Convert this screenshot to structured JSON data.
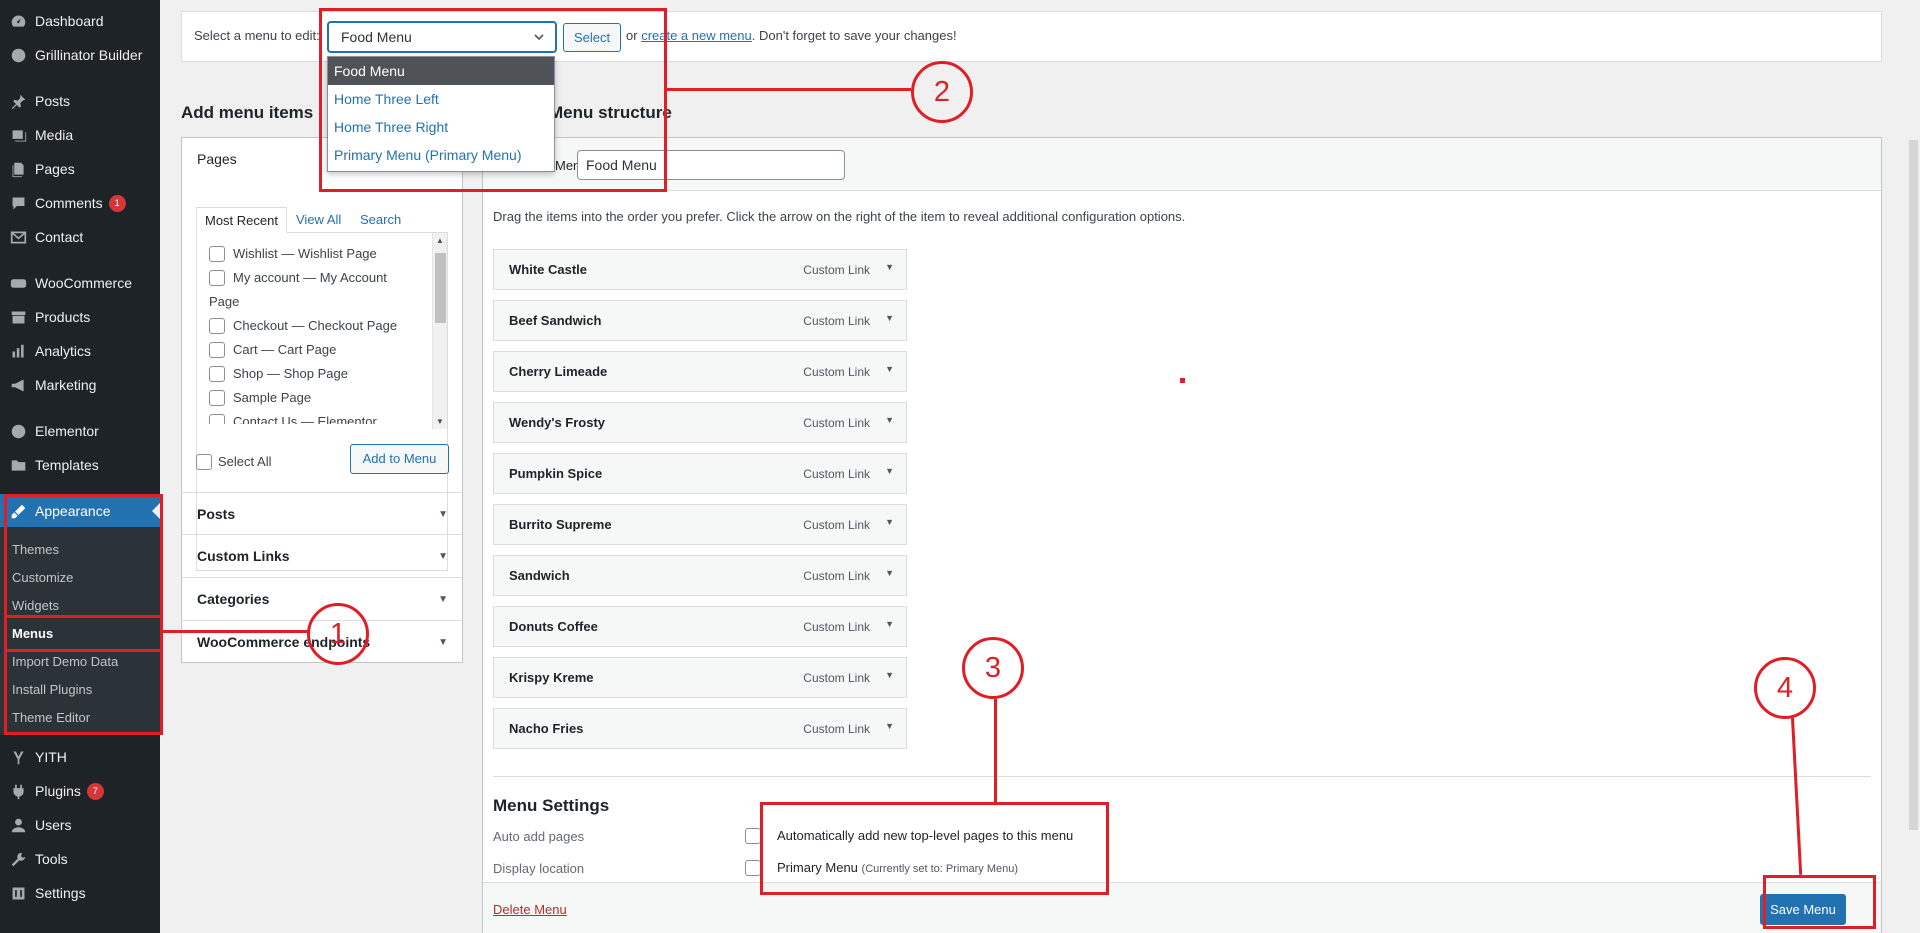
{
  "sidebar": {
    "items": [
      {
        "label": "Dashboard",
        "icon": "dashboard-icon"
      },
      {
        "label": "Grillinator Builder",
        "icon": "globe-icon"
      },
      {
        "label": "Posts",
        "icon": "pin-icon"
      },
      {
        "label": "Media",
        "icon": "media-icon"
      },
      {
        "label": "Pages",
        "icon": "pages-icon"
      },
      {
        "label": "Comments",
        "icon": "comment-icon",
        "badge": "1"
      },
      {
        "label": "Contact",
        "icon": "mail-icon"
      },
      {
        "label": "WooCommerce",
        "icon": "woo-icon"
      },
      {
        "label": "Products",
        "icon": "archive-icon"
      },
      {
        "label": "Analytics",
        "icon": "bar-chart-icon"
      },
      {
        "label": "Marketing",
        "icon": "megaphone-icon"
      },
      {
        "label": "Elementor",
        "icon": "elementor-icon"
      },
      {
        "label": "Templates",
        "icon": "folder-icon"
      },
      {
        "label": "Appearance",
        "icon": "brush-icon"
      },
      {
        "label": "YITH",
        "icon": "yith-icon"
      },
      {
        "label": "Plugins",
        "icon": "plug-icon",
        "badge": "7"
      },
      {
        "label": "Users",
        "icon": "user-icon"
      },
      {
        "label": "Tools",
        "icon": "wrench-icon"
      },
      {
        "label": "Settings",
        "icon": "settings-icon"
      }
    ],
    "submenu": [
      "Themes",
      "Customize",
      "Widgets",
      "Menus",
      "Import Demo Data",
      "Install Plugins",
      "Theme Editor"
    ]
  },
  "top": {
    "label": "Select a menu to edit:",
    "selected": "Food Menu",
    "select_button": "Select",
    "or_text": "or",
    "create_link": "create a new menu",
    "suffix": ". Don't forget to save your changes!",
    "options": [
      "Food Menu",
      "Home Three Left",
      "Home Three Right",
      "Primary Menu (Primary Menu)"
    ]
  },
  "add_items": {
    "heading": "Add menu items",
    "pages_title": "Pages",
    "tabs": [
      "Most Recent",
      "View All",
      "Search"
    ],
    "pages": [
      {
        "title": "Wishlist",
        "sep": " — ",
        "state": "Wishlist Page"
      },
      {
        "title": "My account",
        "sep": " — ",
        "state": "My Account"
      },
      {
        "title": "Page",
        "sep": "",
        "state": ""
      },
      {
        "title": "Checkout",
        "sep": " — ",
        "state": "Checkout Page"
      },
      {
        "title": "Cart",
        "sep": " — ",
        "state": "Cart Page"
      },
      {
        "title": "Shop",
        "sep": " — ",
        "state": "Shop Page"
      },
      {
        "title": "Sample Page",
        "sep": "",
        "state": ""
      },
      {
        "title": "Contact Us",
        "sep": " — ",
        "state": "Elementor"
      }
    ],
    "select_all": "Select All",
    "add_button": "Add to Menu",
    "sections": [
      "Posts",
      "Custom Links",
      "Categories",
      "WooCommerce endpoints"
    ]
  },
  "structure": {
    "heading": "Menu structure",
    "name_label": "Menu Name",
    "name_value": "Food Menu",
    "hint": "Drag the items into the order you prefer. Click the arrow on the right of the item to reveal additional configuration options.",
    "items": [
      {
        "title": "White Castle",
        "type": "Custom Link"
      },
      {
        "title": "Beef Sandwich",
        "type": "Custom Link"
      },
      {
        "title": "Cherry Limeade",
        "type": "Custom Link"
      },
      {
        "title": "Wendy's Frosty",
        "type": "Custom Link"
      },
      {
        "title": "Pumpkin Spice",
        "type": "Custom Link"
      },
      {
        "title": "Burrito Supreme",
        "type": "Custom Link"
      },
      {
        "title": "Sandwich",
        "type": "Custom Link"
      },
      {
        "title": "Donuts Coffee",
        "type": "Custom Link"
      },
      {
        "title": "Krispy Kreme",
        "type": "Custom Link"
      },
      {
        "title": "Nacho Fries",
        "type": "Custom Link"
      }
    ]
  },
  "settings": {
    "title": "Menu Settings",
    "auto_label": "Auto add pages",
    "auto_option": "Automatically add new top-level pages to this menu",
    "location_label": "Display location",
    "location_option": "Primary Menu",
    "location_note": "(Currently set to: Primary Menu)"
  },
  "footer": {
    "delete": "Delete Menu",
    "save": "Save Menu"
  },
  "annotations": [
    "1",
    "2",
    "3",
    "4"
  ],
  "colors": {
    "accent": "#2271b1",
    "annotation": "#e01e26",
    "sidebar": "#1d2327"
  }
}
